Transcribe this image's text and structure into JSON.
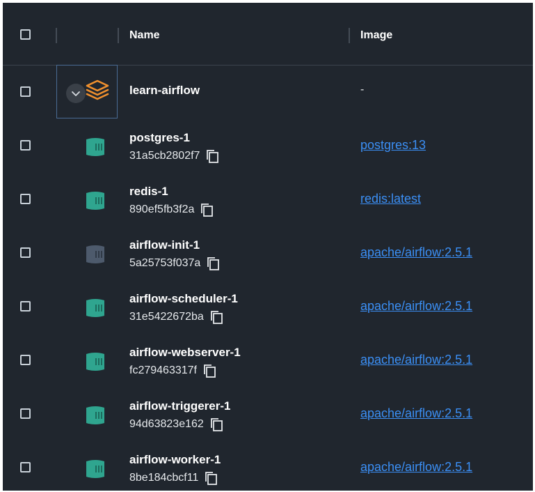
{
  "table": {
    "columns": {
      "name": "Name",
      "image": "Image"
    },
    "group": {
      "name": "learn-airflow",
      "image": "-",
      "icon": "stack-icon",
      "expanded": true
    },
    "containers": [
      {
        "name": "postgres-1",
        "id": "31a5cb2802f7",
        "image": "postgres:13",
        "status": "running"
      },
      {
        "name": "redis-1",
        "id": "890ef5fb3f2a",
        "image": "redis:latest",
        "status": "running"
      },
      {
        "name": "airflow-init-1",
        "id": "5a25753f037a",
        "image": "apache/airflow:2.5.1",
        "status": "exited"
      },
      {
        "name": "airflow-scheduler-1",
        "id": "31e5422672ba",
        "image": "apache/airflow:2.5.1",
        "status": "running"
      },
      {
        "name": "airflow-webserver-1",
        "id": "fc279463317f",
        "image": "apache/airflow:2.5.1",
        "status": "running"
      },
      {
        "name": "airflow-triggerer-1",
        "id": "94d63823e162",
        "image": "apache/airflow:2.5.1",
        "status": "running"
      },
      {
        "name": "airflow-worker-1",
        "id": "8be184cbcf11",
        "image": "apache/airflow:2.5.1",
        "status": "running"
      }
    ]
  },
  "colors": {
    "background": "#20262e",
    "running": "#2fa58f",
    "exited": "#4d5a6c",
    "group_icon": "#f0902e",
    "link": "#3b8ff5"
  },
  "icons": {
    "container": "container-icon",
    "copy": "copy-icon",
    "chevron": "chevron-down-icon"
  }
}
